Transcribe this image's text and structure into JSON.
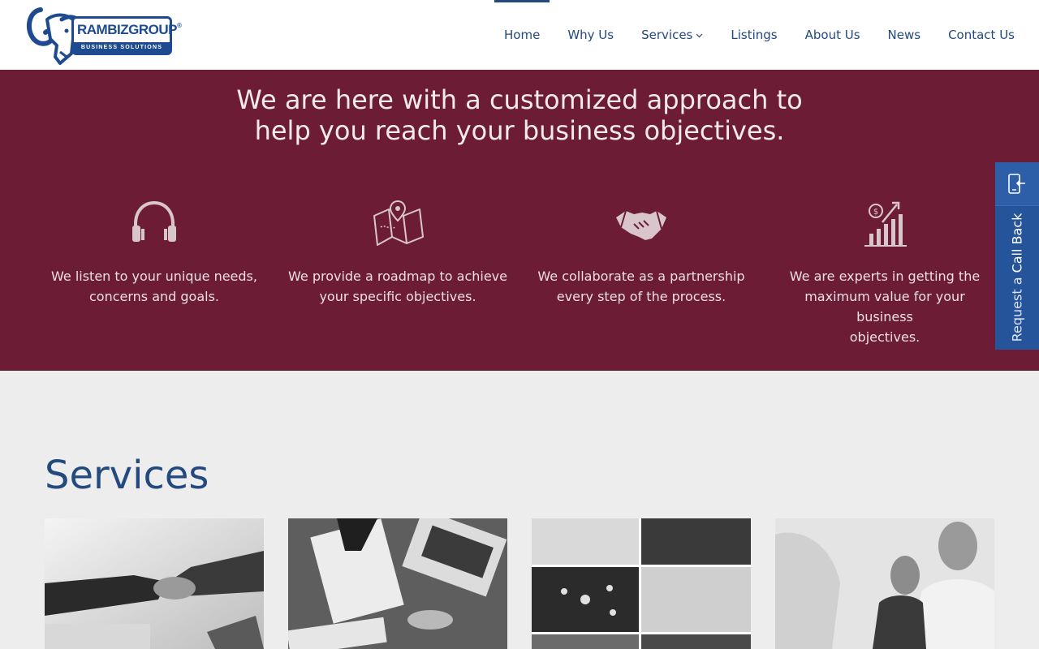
{
  "logo": {
    "title": "RAMBIZGROUP",
    "reg": "®",
    "subtitle": "BUSINESS SOLUTIONS"
  },
  "nav": {
    "items": [
      {
        "label": "Home",
        "active": true
      },
      {
        "label": "Why Us"
      },
      {
        "label": "Services",
        "has_dropdown": true
      },
      {
        "label": "Listings"
      },
      {
        "label": "About Us"
      },
      {
        "label": "News"
      },
      {
        "label": "Contact Us"
      }
    ]
  },
  "hero": {
    "line1": "We are here with a customized approach to",
    "line2": "help you reach your business objectives."
  },
  "features": [
    {
      "icon": "headphones-icon",
      "line1": "We listen to your unique needs,",
      "line2": "concerns and goals."
    },
    {
      "icon": "map-icon",
      "line1": "We provide a roadmap to achieve",
      "line2": "your specific objectives."
    },
    {
      "icon": "handshake-icon",
      "line1": "We collaborate as a partnership",
      "line2": "every step of the process."
    },
    {
      "icon": "growth-chart-icon",
      "line1": "We are experts in getting the",
      "line2": "maximum value for your business",
      "line3": "objectives."
    }
  ],
  "callback": {
    "prefix": "Request a ",
    "emphasis": "Call Back",
    "icon": "phone-callback-icon"
  },
  "services": {
    "title": "Services"
  },
  "colors": {
    "brand_blue": "#24497f",
    "band_maroon": "#6c1d35",
    "callback_blue": "#25549a"
  }
}
